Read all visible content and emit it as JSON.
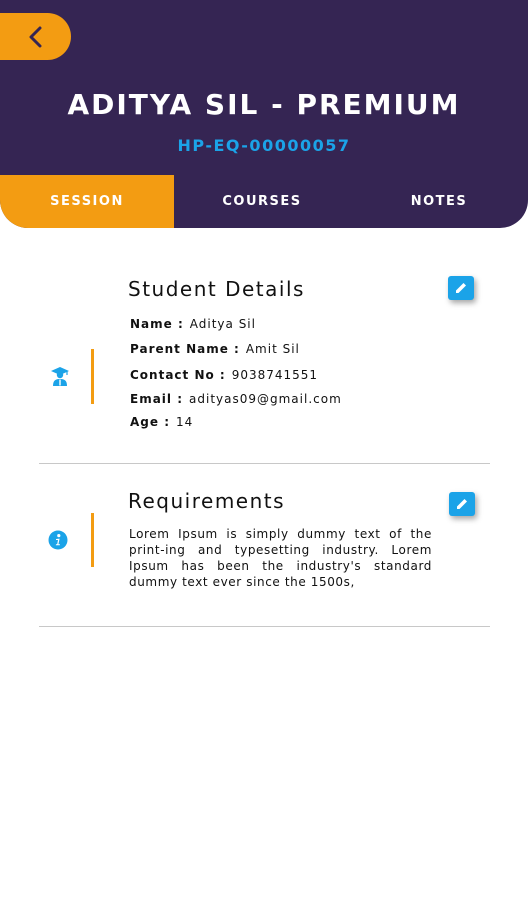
{
  "header": {
    "title": "ADITYA SIL - PREMIUM",
    "subtitle": "HP-EQ-00000057",
    "back_icon": "chevron-left-icon",
    "colors": {
      "background": "#352553",
      "accent": "#f39c12",
      "highlight": "#1ba3e8"
    }
  },
  "tabs": [
    {
      "label": "SESSION",
      "active": true
    },
    {
      "label": "COURSES",
      "active": false
    },
    {
      "label": "NOTES",
      "active": false
    }
  ],
  "student_details": {
    "title": "Student Details",
    "icon": "graduate-icon",
    "edit_icon": "pencil-icon",
    "fields": [
      {
        "label": "Name :",
        "value": "Aditya Sil"
      },
      {
        "label": "Parent Name :",
        "value": "Amit Sil"
      },
      {
        "label": "Contact No :",
        "value": "9038741551"
      },
      {
        "label": "Email :",
        "value": "adityas09@gmail.com"
      },
      {
        "label": "Age :",
        "value": "14"
      }
    ]
  },
  "requirements": {
    "title": "Requirements",
    "icon": "info-icon",
    "edit_icon": "pencil-icon",
    "text": "Lorem Ipsum is simply dummy text of the print-ing and typesetting industry. Lorem Ipsum has been the industry's standard dummy text ever since the 1500s,"
  }
}
